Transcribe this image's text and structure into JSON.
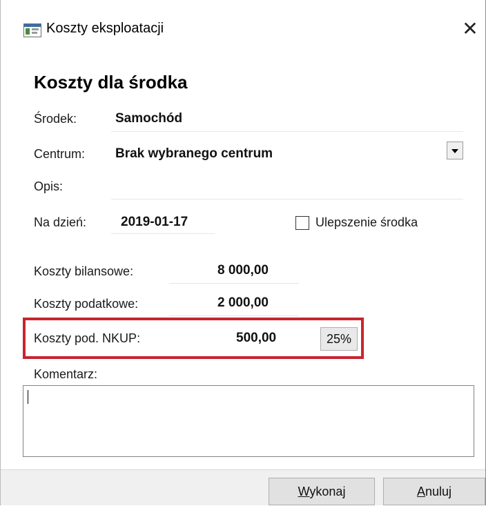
{
  "window": {
    "title": "Koszty eksploatacji",
    "close_glyph": "✕"
  },
  "form": {
    "heading": "Koszty dla środka",
    "srodek_label": "Środek:",
    "srodek_value": "Samochód",
    "centrum_label": "Centrum:",
    "centrum_value": "Brak wybranego centrum",
    "opis_label": "Opis:",
    "opis_value": "",
    "na_dzien_label": "Na dzień:",
    "na_dzien_value": "2019-01-17",
    "ulepszenie_label": "Ulepszenie środka",
    "ulepszenie_checked": false,
    "bilansowe_label": "Koszty bilansowe:",
    "bilansowe_value": "8 000,00",
    "podatkowe_label": "Koszty podatkowe:",
    "podatkowe_value": "2 000,00",
    "nkup_label": "Koszty pod. NKUP:",
    "nkup_value": "500,00",
    "nkup_percent": "25%",
    "komentarz_label": "Komentarz:",
    "komentarz_value": ""
  },
  "footer": {
    "wykonaj_first": "W",
    "wykonaj_rest": "ykonaj",
    "anuluj_first": "A",
    "anuluj_rest": "nuluj"
  },
  "colors": {
    "highlight_border": "#c8242f",
    "footer_bg": "#f0f0f0"
  }
}
